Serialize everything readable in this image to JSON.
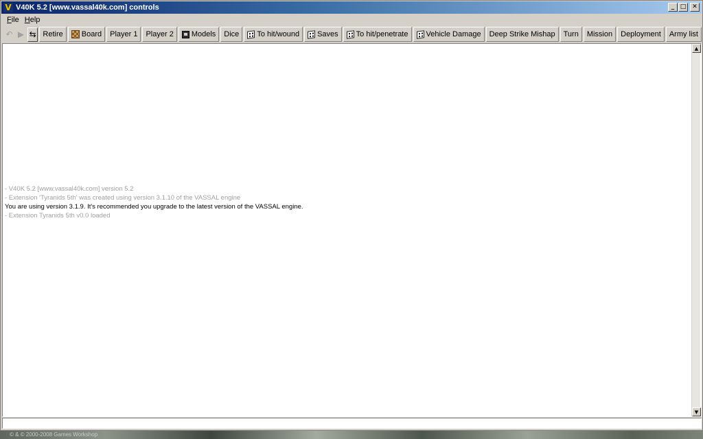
{
  "window": {
    "title": "V40K 5.2 [www.vassal40k.com] controls",
    "icon": "vassal-v-icon",
    "controls": {
      "minimize": "_",
      "maximize": "□",
      "close": "✕"
    }
  },
  "menu": {
    "items": [
      {
        "mnemonic": "F",
        "rest": "ile"
      },
      {
        "mnemonic": "H",
        "rest": "elp"
      }
    ]
  },
  "toolbar": {
    "buttons": [
      {
        "label": "Retire"
      },
      {
        "label": "Board",
        "icon": "board-icon"
      },
      {
        "label": "Player 1"
      },
      {
        "label": "Player 2"
      },
      {
        "label": "Models",
        "icon": "models-icon"
      },
      {
        "label": "Dice"
      },
      {
        "label": "To hit/wound",
        "icon": "dice-icon"
      },
      {
        "label": "Saves",
        "icon": "dice-icon"
      },
      {
        "label": "To hit/penetrate",
        "icon": "dice-icon"
      },
      {
        "label": "Vehicle Damage",
        "icon": "dice-icon"
      },
      {
        "label": "Deep Strike Mishap"
      },
      {
        "label": "Turn"
      },
      {
        "label": "Mission"
      },
      {
        "label": "Deployment"
      },
      {
        "label": "Army list"
      }
    ]
  },
  "chat": {
    "lines": [
      {
        "text": "- V40K 5.2 [www.vassal40k.com] version 5.2",
        "style": "gray"
      },
      {
        "text": "- Extension 'Tyranids 5th' was created using version 3.1.10 of the VASSAL engine",
        "style": "gray"
      },
      {
        "text": "You are using version 3.1.9. It's recommended you upgrade to the latest version of the VASSAL engine.",
        "style": "dark"
      },
      {
        "text": "- Extension Tyranids 5th v0.0 loaded",
        "style": "gray"
      }
    ]
  },
  "desktop": {
    "footer_text": "© & © 2000-2008 Games Workshop"
  }
}
